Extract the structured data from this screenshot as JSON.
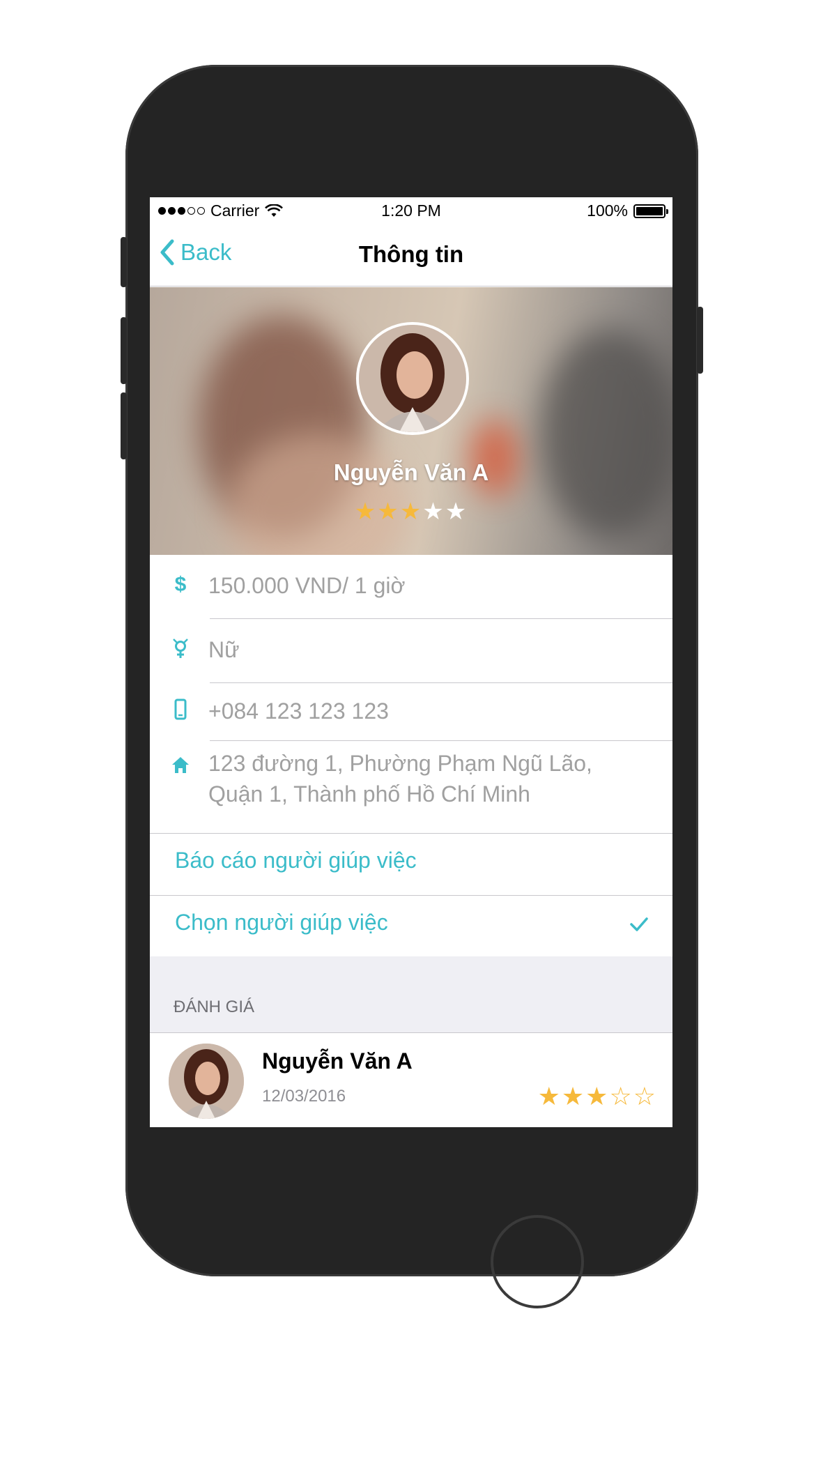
{
  "status_bar": {
    "carrier": "Carrier",
    "time": "1:20 PM",
    "battery": "100%"
  },
  "nav": {
    "back_label": "Back",
    "title": "Thông tin"
  },
  "profile": {
    "name": "Nguyễn Văn A",
    "rating": 3,
    "rating_max": 5
  },
  "info": {
    "price": "150.000 VND/ 1 giờ",
    "gender": "Nữ",
    "phone": "+084 123 123 123",
    "address_line1": "123 đường 1, Phường Phạm Ngũ Lão,",
    "address_line2": "Quận 1, Thành phố Hồ Chí Minh"
  },
  "actions": {
    "report_label": "Báo cáo người giúp việc",
    "choose_label": "Chọn người giúp việc"
  },
  "reviews_section": {
    "title": "ĐÁNH GIÁ",
    "items": [
      {
        "name": "Nguyễn Văn A",
        "date": "12/03/2016",
        "rating": 3,
        "rating_max": 5
      }
    ]
  },
  "colors": {
    "accent": "#3bbcc9",
    "star_filled": "#f6b93b",
    "star_empty_header": "#ffffff",
    "text_muted": "#a0a0a0"
  },
  "icons": {
    "back": "chevron-left-icon",
    "price": "dollar-icon",
    "gender": "gender-icon",
    "phone": "mobile-phone-icon",
    "address": "home-icon",
    "selected": "checkmark-icon"
  }
}
